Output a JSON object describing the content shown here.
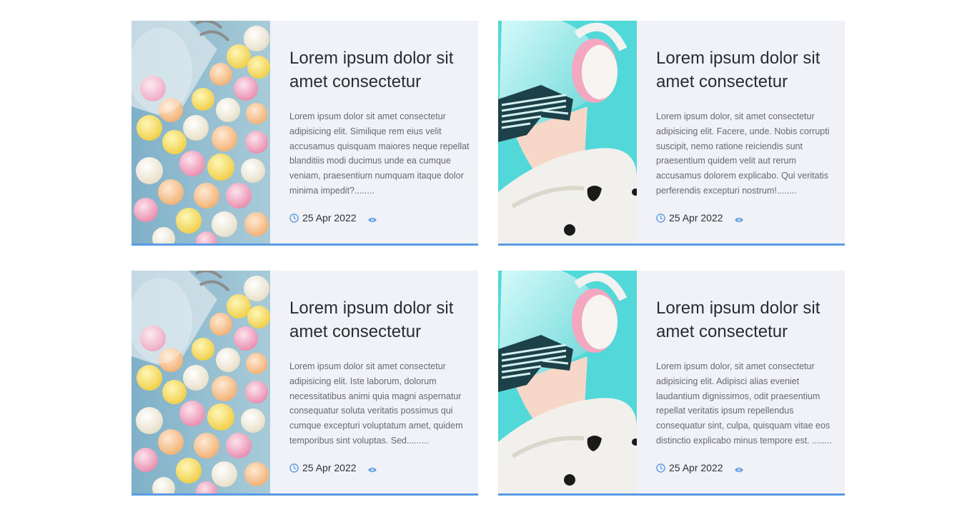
{
  "colors": {
    "accent": "#5b9be6",
    "card_bg": "#f1f2f7",
    "title": "#2b2b33",
    "excerpt": "#666872"
  },
  "cards": [
    {
      "image": "candy-jar",
      "title": "Lorem ipsum dolor sit amet consectetur",
      "excerpt": "Lorem ipsum dolor sit amet consectetur adipisicing elit. Similique rem eius velit accusamus quisquam maiores neque repellat blanditiis modi ducimus unde ea cumque veniam, praesentium numquam itaque dolor minima impedit?........",
      "date": "25 Apr 2022",
      "date_icon": "clock-icon",
      "views_icon": "eye-icon"
    },
    {
      "image": "girl-headphones",
      "title": "Lorem ipsum dolor sit amet consectetur",
      "excerpt": "Lorem ipsum dolor, sit amet consectetur adipisicing elit. Facere, unde. Nobis corrupti suscipit, nemo ratione reiciendis sunt praesentium quidem velit aut rerum accusamus dolorem explicabo. Qui veritatis perferendis excepturi nostrum!........",
      "date": "25 Apr 2022",
      "date_icon": "clock-icon",
      "views_icon": "eye-icon"
    },
    {
      "image": "candy-jar",
      "title": "Lorem ipsum dolor sit amet consectetur",
      "excerpt": "Lorem ipsum dolor sit amet consectetur adipisicing elit. Iste laborum, dolorum necessitatibus animi quia magni aspernatur consequatur soluta veritatis possimus qui cumque excepturi voluptatum amet, quidem temporibus sint voluptas. Sed.........",
      "date": "25 Apr 2022",
      "date_icon": "clock-icon",
      "views_icon": "eye-icon"
    },
    {
      "image": "girl-headphones",
      "title": "Lorem ipsum dolor sit amet consectetur",
      "excerpt": "Lorem ipsum dolor, sit amet consectetur adipisicing elit. Adipisci alias eveniet laudantium dignissimos, odit praesentium repellat veritatis ipsum repellendus consequatur sint, culpa, quisquam vitae eos distinctio explicabo minus tempore est. ........",
      "date": "25 Apr 2022",
      "date_icon": "clock-icon",
      "views_icon": "eye-icon"
    }
  ]
}
